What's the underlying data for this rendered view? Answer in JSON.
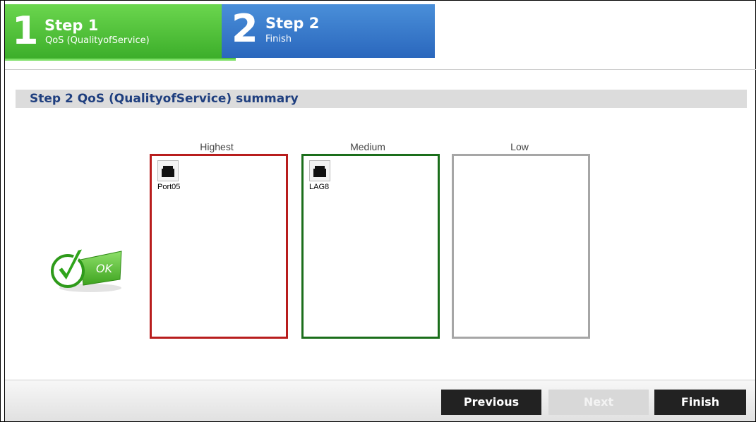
{
  "wizard": {
    "steps": [
      {
        "number": "1",
        "title": "Step 1",
        "subtitle": "QoS (QualityofService)",
        "state": "active"
      },
      {
        "number": "2",
        "title": "Step 2",
        "subtitle": "Finish",
        "state": "inactive"
      }
    ]
  },
  "summary": {
    "title": "Step 2 QoS (QualityofService) summary"
  },
  "queues": [
    {
      "label": "Highest",
      "color": "#b81d1d",
      "items": [
        {
          "name": "Port05",
          "icon": "ethernet-port-icon"
        }
      ]
    },
    {
      "label": "Medium",
      "color": "#1b6e1b",
      "items": [
        {
          "name": "LAG8",
          "icon": "ethernet-port-icon"
        }
      ]
    },
    {
      "label": "Low",
      "color": "#a6a6a6",
      "items": []
    }
  ],
  "status": {
    "icon": "ok-check-icon",
    "text": "OK"
  },
  "footer": {
    "previous_label": "Previous",
    "next_label": "Next",
    "finish_label": "Finish",
    "next_enabled": false
  }
}
